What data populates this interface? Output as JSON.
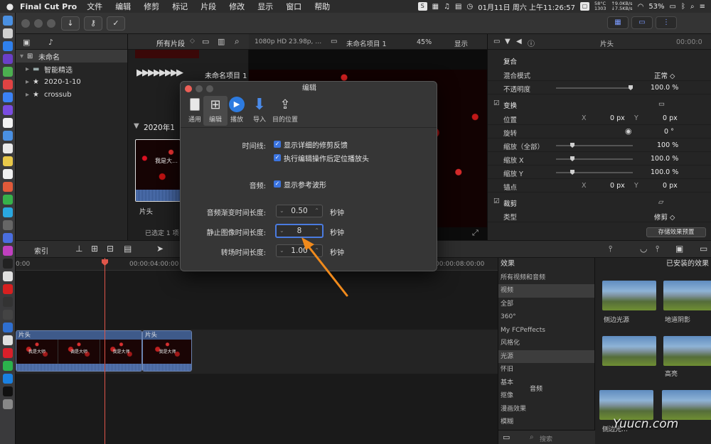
{
  "menubar": {
    "app_name": "Final Cut Pro",
    "items": [
      "文件",
      "编辑",
      "修剪",
      "标记",
      "片段",
      "修改",
      "显示",
      "窗口",
      "帮助"
    ],
    "temp": "58°C",
    "fan": "1303",
    "net_up": "↑9.0KB/s",
    "net_down": "↓7.5KB/s",
    "battery": "53%",
    "datetime": "01月11日 周六 上午11:26:57"
  },
  "library": {
    "filter": "所有片段",
    "items": [
      {
        "label": "未命名",
        "icon": "grid-icon"
      },
      {
        "label": "智能精选",
        "icon": "folder-icon"
      },
      {
        "label": "2020-1-10",
        "icon": "star-icon"
      },
      {
        "label": "crossub",
        "icon": "star-icon"
      }
    ]
  },
  "browser": {
    "project_name": "未命名项目 1",
    "date_group": "2020年1",
    "clip_label": "片头",
    "clip_title": "我是大…",
    "selection": "已选定 1 项"
  },
  "viewer": {
    "format": "1080p HD 23.98p, …",
    "project": "未命名项目 1",
    "zoom": "45%",
    "view_menu": "显示"
  },
  "inspector": {
    "title": "片头",
    "timecode": "00:00:0",
    "sections": {
      "composite": "复合",
      "transform": "变换",
      "crop": "裁剪"
    },
    "rows": {
      "blend_mode": {
        "label": "混合模式",
        "value": "正常 ◇"
      },
      "opacity": {
        "label": "不透明度",
        "value": "100.0 %",
        "level": 1.0
      },
      "position": {
        "label": "位置",
        "x_label": "X",
        "x": "0 px",
        "y_label": "Y",
        "y": "0 px"
      },
      "rotation": {
        "label": "旋转",
        "value": "0 °"
      },
      "scale_all": {
        "label": "缩放（全部）",
        "value": "100 %"
      },
      "scale_x": {
        "label": "缩放 X",
        "value": "100.0 %"
      },
      "scale_y": {
        "label": "缩放 Y",
        "value": "100.0 %"
      },
      "anchor": {
        "label": "锚点",
        "x_label": "X",
        "x": "0 px",
        "y_label": "Y",
        "y": "0 px"
      },
      "crop_type": {
        "label": "类型",
        "value": "修剪 ◇"
      }
    },
    "save_preset": "存储效果预置"
  },
  "timeline_bar": {
    "index": "索引"
  },
  "timeline": {
    "timecodes": [
      "0:00",
      "00:00:04:00:00",
      "00:00:08:00:00"
    ],
    "clip1": {
      "label": "片头",
      "thumbs": [
        "我是大师",
        "调是大师",
        "我是大师"
      ]
    },
    "clip2": {
      "label": "片头",
      "thumbs": [
        "我是大师"
      ]
    }
  },
  "effects": {
    "header": "效果",
    "installed": "已安装的效果",
    "categories": [
      "所有视频和音频",
      "视频",
      "全部",
      "360°",
      "My FCPeffects",
      "风格化",
      "光源",
      "怀旧",
      "基本",
      "抠像",
      "漫画效果",
      "模糊"
    ],
    "selected_category": "光源",
    "audio_label": "音频",
    "tiles": [
      "侧边光源",
      "地道阴影",
      "",
      "高亮",
      "侧边光…",
      ""
    ],
    "search_placeholder": "搜索"
  },
  "dialog": {
    "title": "编辑",
    "tabs": [
      "通用",
      "编辑",
      "播放",
      "导入",
      "目的位置"
    ],
    "timeline_label": "时间线:",
    "check_detailed_trim": "显示详细的修剪反馈",
    "check_position_playhead": "执行编辑操作后定位播放头",
    "audio_label": "音频:",
    "check_ref_waveform": "显示参考波形",
    "audio_fade_label": "音频渐变时间长度:",
    "audio_fade_value": "0.50",
    "still_image_label": "静止图像时间长度:",
    "still_image_value": "8",
    "transition_label": "转场时间长度:",
    "transition_value": "1.00",
    "unit": "秒钟"
  },
  "watermark": "Yuucn.com",
  "colors": {
    "accent": "#3b74e0",
    "arrow": "#f08a1c",
    "playhead": "#e0564a"
  }
}
